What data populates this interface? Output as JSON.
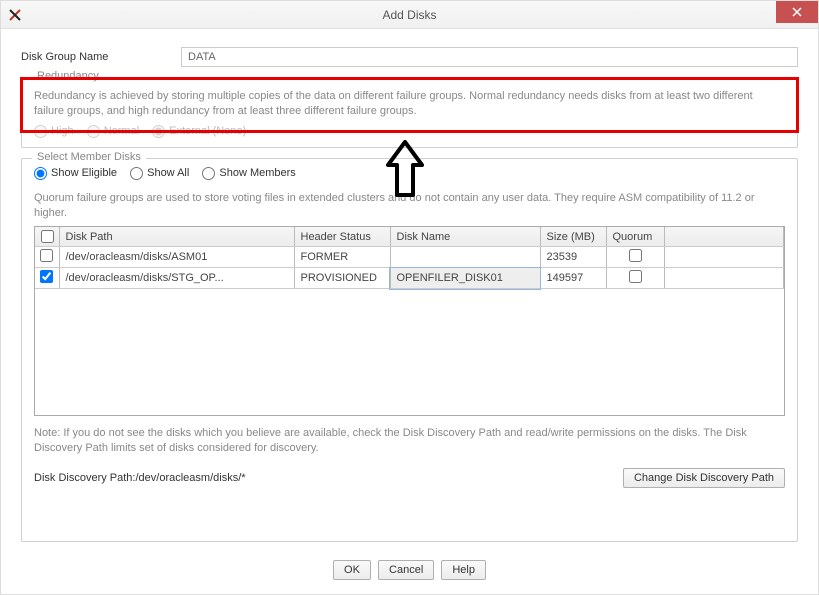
{
  "window": {
    "title": "Add Disks"
  },
  "disk_group_name": {
    "label": "Disk Group Name",
    "value": "DATA"
  },
  "redundancy": {
    "legend": "Redundancy",
    "description": "Redundancy is achieved by storing multiple copies of the data on different failure groups. Normal redundancy needs disks from at least two different failure groups, and high redundancy from at least three different failure groups.",
    "options": {
      "high": "High",
      "normal": "Normal",
      "external": "External (None)"
    },
    "selected": "external"
  },
  "member_disks": {
    "legend": "Select Member Disks",
    "filter_options": {
      "eligible": "Show Eligible",
      "all": "Show All",
      "members": "Show Members"
    },
    "filter_selected": "eligible",
    "quorum_desc": "Quorum failure groups are used to store voting files in extended clusters and do not contain any user data. They require ASM compatibility of 11.2 or higher.",
    "columns": {
      "disk_path": "Disk Path",
      "header_status": "Header Status",
      "disk_name": "Disk Name",
      "size_mb": "Size (MB)",
      "quorum": "Quorum"
    },
    "rows": [
      {
        "checked": false,
        "disk_path": "/dev/oracleasm/disks/ASM01",
        "header_status": "FORMER",
        "disk_name": "",
        "size_mb": "23539",
        "quorum": false
      },
      {
        "checked": true,
        "disk_path": "/dev/oracleasm/disks/STG_OP...",
        "header_status": "PROVISIONED",
        "disk_name": "OPENFILER_DISK01",
        "size_mb": "149597",
        "quorum": false
      }
    ],
    "note": "Note: If you do not see the disks which you believe are available, check the Disk Discovery Path and read/write permissions on the disks. The Disk Discovery Path limits set of disks considered for discovery.",
    "discovery_label": "Disk Discovery Path:",
    "discovery_value": "/dev/oracleasm/disks/*",
    "change_button": "Change Disk Discovery Path"
  },
  "buttons": {
    "ok": "OK",
    "cancel": "Cancel",
    "help": "Help"
  }
}
